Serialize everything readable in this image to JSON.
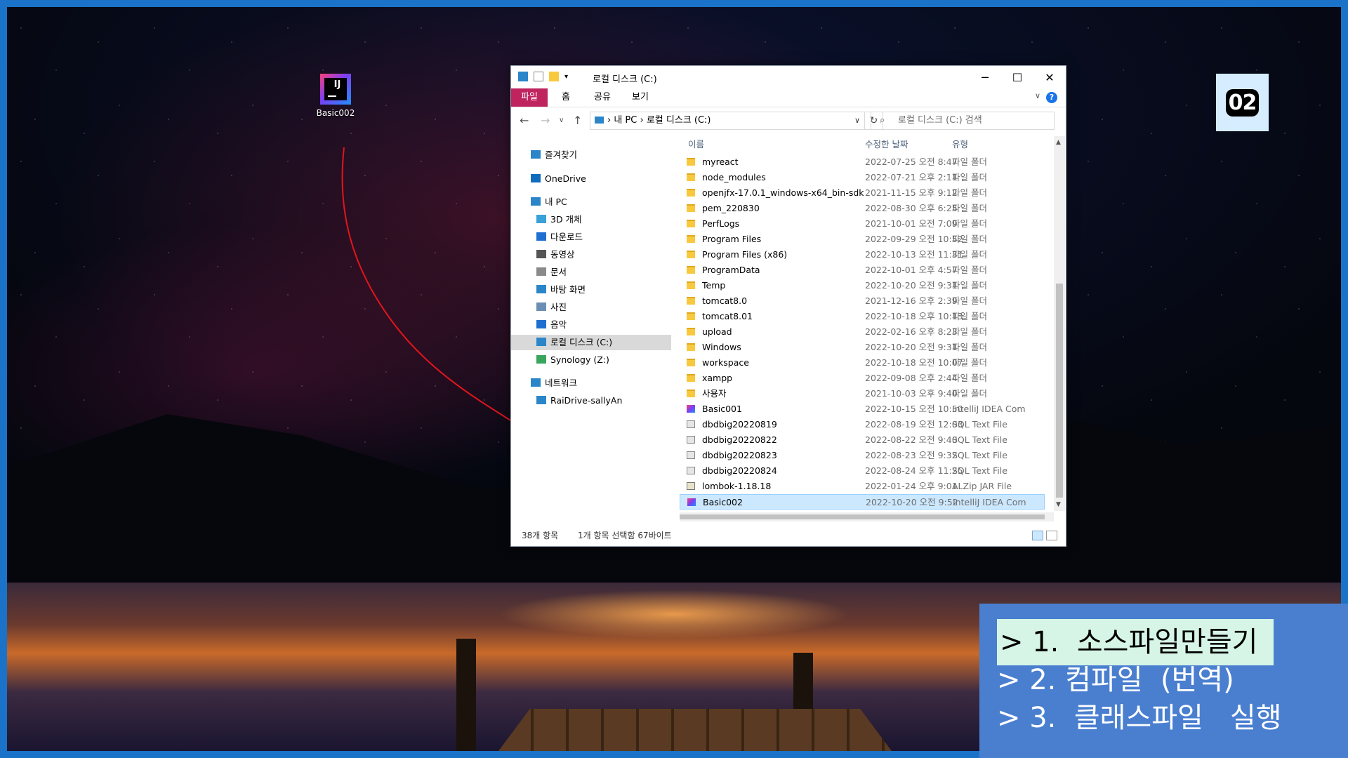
{
  "desktop": {
    "icon_label": "Basic002",
    "icon_glyph": "IJ"
  },
  "badge": {
    "text": "02"
  },
  "steps": [
    {
      "label": "> 1.  소스파일만들기",
      "active": true
    },
    {
      "label": "> 2. 컴파일  (번역)",
      "active": false
    },
    {
      "label": "> 3.  클래스파일   실행",
      "active": false
    }
  ],
  "explorer": {
    "title": "로컬 디스크 (C:)",
    "window_controls": {
      "minimize": "─",
      "maximize": "☐",
      "close": "✕"
    },
    "ribbon_tabs": [
      "파일",
      "홈",
      "공유",
      "보기"
    ],
    "help": "?",
    "breadcrumb": [
      "내 PC",
      "로컬 디스크 (C:)"
    ],
    "search_placeholder": "로컬 디스크 (C:) 검색",
    "sidebar": [
      {
        "label": "즐겨찾기",
        "icon": "star-icon",
        "color": "#2b86c9"
      },
      {
        "label": "OneDrive",
        "icon": "cloud-icon",
        "color": "#0f6cbd"
      },
      {
        "label": "내 PC",
        "icon": "pc-icon",
        "color": "#2b86c9"
      },
      {
        "label": "3D 개체",
        "icon": "cube-icon",
        "color": "#39a0d8"
      },
      {
        "label": "다운로드",
        "icon": "download-icon",
        "color": "#1f6fd1"
      },
      {
        "label": "동영상",
        "icon": "video-icon",
        "color": "#555555"
      },
      {
        "label": "문서",
        "icon": "document-icon",
        "color": "#8a8a8a"
      },
      {
        "label": "바탕 화면",
        "icon": "desktop-icon",
        "color": "#2b86c9"
      },
      {
        "label": "사진",
        "icon": "picture-icon",
        "color": "#6b8fb3"
      },
      {
        "label": "음악",
        "icon": "music-icon",
        "color": "#1f6fd1"
      },
      {
        "label": "로컬 디스크 (C:)",
        "icon": "drive-icon",
        "color": "#2b86c9",
        "selected": true
      },
      {
        "label": "Synology (Z:)",
        "icon": "network-drive-icon",
        "color": "#3aa55d"
      },
      {
        "label": "네트워크",
        "icon": "network-icon",
        "color": "#2b86c9"
      },
      {
        "label": "RaiDrive-sallyAn",
        "icon": "raidrive-icon",
        "color": "#2b86c9"
      }
    ],
    "columns": {
      "name": "이름",
      "date": "수정한 날짜",
      "type": "유형"
    },
    "files": [
      {
        "name": "myreact",
        "date": "2022-07-25 오전 8:47",
        "type": "파일 폴더",
        "kind": "folder"
      },
      {
        "name": "node_modules",
        "date": "2022-07-21 오후 2:11",
        "type": "파일 폴더",
        "kind": "folder"
      },
      {
        "name": "openjfx-17.0.1_windows-x64_bin-sdk",
        "date": "2021-11-15 오후 9:12",
        "type": "파일 폴더",
        "kind": "folder"
      },
      {
        "name": "pem_220830",
        "date": "2022-08-30 오후 6:25",
        "type": "파일 폴더",
        "kind": "folder"
      },
      {
        "name": "PerfLogs",
        "date": "2021-10-01 오전 7:09",
        "type": "파일 폴더",
        "kind": "folder"
      },
      {
        "name": "Program Files",
        "date": "2022-09-29 오전 10:52",
        "type": "파일 폴더",
        "kind": "folder"
      },
      {
        "name": "Program Files (x86)",
        "date": "2022-10-13 오전 11:31",
        "type": "파일 폴더",
        "kind": "folder"
      },
      {
        "name": "ProgramData",
        "date": "2022-10-01 오후 4:57",
        "type": "파일 폴더",
        "kind": "folder"
      },
      {
        "name": "Temp",
        "date": "2022-10-20 오전 9:31",
        "type": "파일 폴더",
        "kind": "folder"
      },
      {
        "name": "tomcat8.0",
        "date": "2021-12-16 오후 2:39",
        "type": "파일 폴더",
        "kind": "folder"
      },
      {
        "name": "tomcat8.01",
        "date": "2022-10-18 오후 10:13",
        "type": "파일 폴더",
        "kind": "folder"
      },
      {
        "name": "upload",
        "date": "2022-02-16 오후 8:23",
        "type": "파일 폴더",
        "kind": "folder"
      },
      {
        "name": "Windows",
        "date": "2022-10-20 오전 9:31",
        "type": "파일 폴더",
        "kind": "folder"
      },
      {
        "name": "workspace",
        "date": "2022-10-18 오전 10:07",
        "type": "파일 폴더",
        "kind": "folder"
      },
      {
        "name": "xampp",
        "date": "2022-09-08 오후 2:44",
        "type": "파일 폴더",
        "kind": "folder"
      },
      {
        "name": "사용자",
        "date": "2021-10-03 오후 9:40",
        "type": "파일 폴더",
        "kind": "folder"
      },
      {
        "name": "Basic001",
        "date": "2022-10-15 오전 10:50",
        "type": "IntelliJ IDEA Com",
        "kind": "intellij"
      },
      {
        "name": "dbdbig20220819",
        "date": "2022-08-19 오전 12:03",
        "type": "SQL Text File",
        "kind": "sql"
      },
      {
        "name": "dbdbig20220822",
        "date": "2022-08-22 오전 9:40",
        "type": "SQL Text File",
        "kind": "sql"
      },
      {
        "name": "dbdbig20220823",
        "date": "2022-08-23 오전 9:32",
        "type": "SQL Text File",
        "kind": "sql"
      },
      {
        "name": "dbdbig20220824",
        "date": "2022-08-24 오후 11:25",
        "type": "SQL Text File",
        "kind": "sql"
      },
      {
        "name": "lombok-1.18.18",
        "date": "2022-01-24 오후 9:01",
        "type": "ALZip JAR File",
        "kind": "jar"
      },
      {
        "name": "Basic002",
        "date": "2022-10-20 오전 9:52",
        "type": "IntelliJ IDEA Com",
        "kind": "intellij",
        "selected": true
      }
    ],
    "status": {
      "count": "38개 항목",
      "selection": "1개 항목 선택함 67바이트"
    }
  }
}
